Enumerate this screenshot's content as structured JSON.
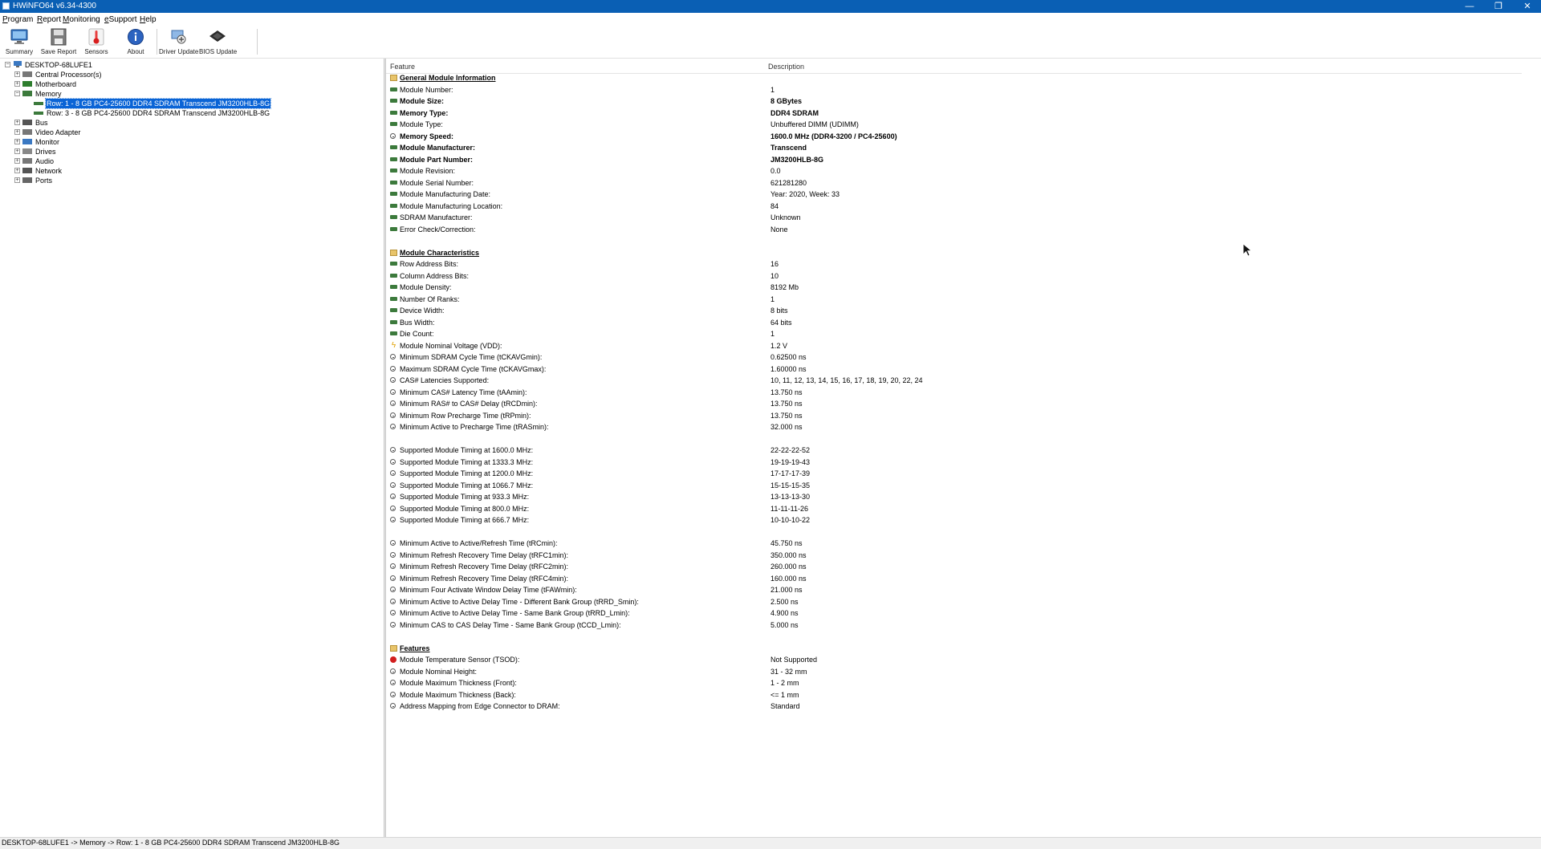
{
  "window": {
    "title": "HWiNFO64 v6.34-4300",
    "controls": {
      "minimize": "—",
      "restore": "❐",
      "close": "✕"
    }
  },
  "menu": [
    "Program",
    "Report",
    "Monitoring",
    "eSupport",
    "Help"
  ],
  "toolbar": [
    {
      "label": "Summary",
      "icon": "monitor-icon"
    },
    {
      "label": "Save Report",
      "icon": "floppy-disk-icon"
    },
    {
      "label": "Sensors",
      "icon": "thermometer-icon"
    },
    {
      "label": "About",
      "icon": "info-icon"
    },
    {
      "label": "Driver Update",
      "icon": "driver-update-icon"
    },
    {
      "label": "BIOS Update",
      "icon": "chip-icon"
    }
  ],
  "tree": {
    "root": "DESKTOP-68LUFE1",
    "items": [
      {
        "label": "Central Processor(s)",
        "expander": "+"
      },
      {
        "label": "Motherboard",
        "expander": "+"
      },
      {
        "label": "Memory",
        "expander": "−"
      },
      {
        "label": "Row: 1 - 8 GB PC4-25600 DDR4 SDRAM Transcend JM3200HLB-8G",
        "selected": true
      },
      {
        "label": "Row: 3 - 8 GB PC4-25600 DDR4 SDRAM Transcend JM3200HLB-8G"
      },
      {
        "label": "Bus",
        "expander": "+"
      },
      {
        "label": "Video Adapter",
        "expander": "+"
      },
      {
        "label": "Monitor",
        "expander": "+"
      },
      {
        "label": "Drives",
        "expander": "+"
      },
      {
        "label": "Audio",
        "expander": "+"
      },
      {
        "label": "Network",
        "expander": "+"
      },
      {
        "label": "Ports",
        "expander": "+"
      }
    ]
  },
  "detail": {
    "headers": {
      "feature": "Feature",
      "description": "Description"
    },
    "rows": [
      {
        "type": "section",
        "feature": "General Module Information",
        "desc": ""
      },
      {
        "type": "item",
        "icon": "green",
        "feature": "Module Number:",
        "desc": "1"
      },
      {
        "type": "item",
        "icon": "green",
        "bold": true,
        "feature": "Module Size:",
        "desc": "8 GBytes"
      },
      {
        "type": "item",
        "icon": "green",
        "bold": true,
        "feature": "Memory Type:",
        "desc": "DDR4 SDRAM"
      },
      {
        "type": "item",
        "icon": "green",
        "feature": "Module Type:",
        "desc": "Unbuffered DIMM (UDIMM)"
      },
      {
        "type": "item",
        "icon": "clock",
        "bold": true,
        "feature": "Memory Speed:",
        "desc": "1600.0 MHz (DDR4-3200 / PC4-25600)"
      },
      {
        "type": "item",
        "icon": "green",
        "bold": true,
        "feature": "Module Manufacturer:",
        "desc": "Transcend"
      },
      {
        "type": "item",
        "icon": "green",
        "bold": true,
        "feature": "Module Part Number:",
        "desc": "JM3200HLB-8G"
      },
      {
        "type": "item",
        "icon": "green",
        "feature": "Module Revision:",
        "desc": "0.0"
      },
      {
        "type": "item",
        "icon": "green",
        "feature": "Module Serial Number:",
        "desc": "621281280"
      },
      {
        "type": "item",
        "icon": "green",
        "feature": "Module Manufacturing Date:",
        "desc": "Year: 2020, Week: 33"
      },
      {
        "type": "item",
        "icon": "green",
        "feature": "Module Manufacturing Location:",
        "desc": "84"
      },
      {
        "type": "item",
        "icon": "green",
        "feature": "SDRAM Manufacturer:",
        "desc": "Unknown"
      },
      {
        "type": "item",
        "icon": "green",
        "feature": "Error Check/Correction:",
        "desc": "None"
      },
      {
        "type": "blank"
      },
      {
        "type": "section",
        "feature": "Module Characteristics",
        "desc": ""
      },
      {
        "type": "item",
        "icon": "green",
        "feature": "Row Address Bits:",
        "desc": "16"
      },
      {
        "type": "item",
        "icon": "green",
        "feature": "Column Address Bits:",
        "desc": "10"
      },
      {
        "type": "item",
        "icon": "green",
        "feature": "Module Density:",
        "desc": "8192 Mb"
      },
      {
        "type": "item",
        "icon": "green",
        "feature": "Number Of Ranks:",
        "desc": "1"
      },
      {
        "type": "item",
        "icon": "green",
        "feature": "Device Width:",
        "desc": "8 bits"
      },
      {
        "type": "item",
        "icon": "green",
        "feature": "Bus Width:",
        "desc": "64 bits"
      },
      {
        "type": "item",
        "icon": "green",
        "feature": "Die Count:",
        "desc": "1"
      },
      {
        "type": "item",
        "icon": "bolt",
        "feature": "Module Nominal Voltage (VDD):",
        "desc": "1.2 V"
      },
      {
        "type": "item",
        "icon": "clock",
        "feature": "Minimum SDRAM Cycle Time (tCKAVGmin):",
        "desc": "0.62500 ns"
      },
      {
        "type": "item",
        "icon": "clock",
        "feature": "Maximum SDRAM Cycle Time (tCKAVGmax):",
        "desc": "1.60000 ns"
      },
      {
        "type": "item",
        "icon": "clock",
        "feature": "CAS# Latencies Supported:",
        "desc": "10, 11, 12, 13, 14, 15, 16, 17, 18, 19, 20, 22, 24"
      },
      {
        "type": "item",
        "icon": "clock",
        "feature": "Minimum CAS# Latency Time (tAAmin):",
        "desc": "13.750 ns"
      },
      {
        "type": "item",
        "icon": "clock",
        "feature": "Minimum RAS# to CAS# Delay (tRCDmin):",
        "desc": "13.750 ns"
      },
      {
        "type": "item",
        "icon": "clock",
        "feature": "Minimum Row Precharge Time (tRPmin):",
        "desc": "13.750 ns"
      },
      {
        "type": "item",
        "icon": "clock",
        "feature": "Minimum Active to Precharge Time (tRASmin):",
        "desc": "32.000 ns"
      },
      {
        "type": "blank"
      },
      {
        "type": "item",
        "icon": "clock",
        "feature": "Supported Module Timing at 1600.0 MHz:",
        "desc": "22-22-22-52"
      },
      {
        "type": "item",
        "icon": "clock",
        "feature": "Supported Module Timing at 1333.3 MHz:",
        "desc": "19-19-19-43"
      },
      {
        "type": "item",
        "icon": "clock",
        "feature": "Supported Module Timing at 1200.0 MHz:",
        "desc": "17-17-17-39"
      },
      {
        "type": "item",
        "icon": "clock",
        "feature": "Supported Module Timing at 1066.7 MHz:",
        "desc": "15-15-15-35"
      },
      {
        "type": "item",
        "icon": "clock",
        "feature": "Supported Module Timing at 933.3 MHz:",
        "desc": "13-13-13-30"
      },
      {
        "type": "item",
        "icon": "clock",
        "feature": "Supported Module Timing at 800.0 MHz:",
        "desc": "11-11-11-26"
      },
      {
        "type": "item",
        "icon": "clock",
        "feature": "Supported Module Timing at 666.7 MHz:",
        "desc": "10-10-10-22"
      },
      {
        "type": "blank"
      },
      {
        "type": "item",
        "icon": "clock",
        "feature": "Minimum Active to Active/Refresh Time (tRCmin):",
        "desc": "45.750 ns"
      },
      {
        "type": "item",
        "icon": "clock",
        "feature": "Minimum Refresh Recovery Time Delay (tRFC1min):",
        "desc": "350.000 ns"
      },
      {
        "type": "item",
        "icon": "clock",
        "feature": "Minimum Refresh Recovery Time Delay (tRFC2min):",
        "desc": "260.000 ns"
      },
      {
        "type": "item",
        "icon": "clock",
        "feature": "Minimum Refresh Recovery Time Delay (tRFC4min):",
        "desc": "160.000 ns"
      },
      {
        "type": "item",
        "icon": "clock",
        "feature": "Minimum Four Activate Window Delay Time (tFAWmin):",
        "desc": "21.000 ns"
      },
      {
        "type": "item",
        "icon": "clock",
        "feature": "Minimum Active to Active Delay Time - Different Bank Group (tRRD_Smin):",
        "desc": "2.500 ns"
      },
      {
        "type": "item",
        "icon": "clock",
        "feature": "Minimum Active to Active Delay Time - Same Bank Group (tRRD_Lmin):",
        "desc": "4.900 ns"
      },
      {
        "type": "item",
        "icon": "clock",
        "feature": "Minimum CAS to CAS Delay Time - Same Bank Group (tCCD_Lmin):",
        "desc": "5.000 ns"
      },
      {
        "type": "blank"
      },
      {
        "type": "section",
        "feature": "Features",
        "desc": ""
      },
      {
        "type": "item",
        "icon": "red",
        "feature": "Module Temperature Sensor (TSOD):",
        "desc": "Not Supported"
      },
      {
        "type": "item",
        "icon": "clock",
        "feature": "Module Nominal Height:",
        "desc": "31 - 32 mm"
      },
      {
        "type": "item",
        "icon": "clock",
        "feature": "Module Maximum Thickness (Front):",
        "desc": "1 - 2 mm"
      },
      {
        "type": "item",
        "icon": "clock",
        "feature": "Module Maximum Thickness (Back):",
        "desc": "<= 1 mm"
      },
      {
        "type": "item",
        "icon": "clock",
        "feature": "Address Mapping from Edge Connector to DRAM:",
        "desc": "Standard"
      }
    ]
  },
  "statusbar": "DESKTOP-68LUFE1 -> Memory -> Row: 1 - 8 GB PC4-25600 DDR4 SDRAM Transcend JM3200HLB-8G"
}
